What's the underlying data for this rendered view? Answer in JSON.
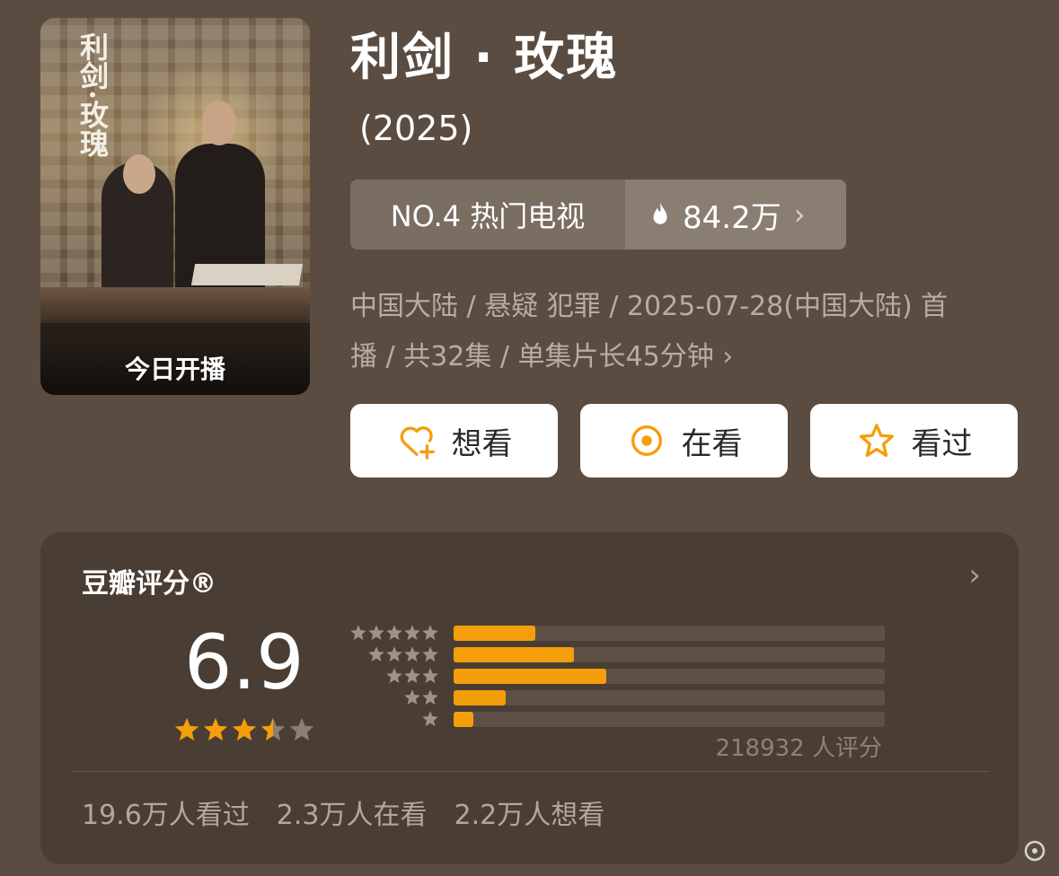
{
  "poster": {
    "vertical_title": "利剑·玫瑰",
    "caption": "今日开播"
  },
  "header": {
    "title": "利剑 · 玫瑰",
    "year": "(2025)"
  },
  "rank": {
    "label": "NO.4 热门电视",
    "heat": "84.2万",
    "chevron": "›",
    "flame_icon": "flame-icon"
  },
  "meta": {
    "line1": "中国大陆 / 悬疑 犯罪 / 2025-07-28(中国大陆) 首",
    "line2": "播 / 共32集 / 单集片长45分钟",
    "chevron": "›"
  },
  "actions": [
    {
      "label": "想看",
      "icon": "heart-plus-icon"
    },
    {
      "label": "在看",
      "icon": "target-icon"
    },
    {
      "label": "看过",
      "icon": "star-outline-icon"
    }
  ],
  "rating": {
    "title": "豆瓣评分®",
    "chevron": "›",
    "score": "6.9",
    "stars": 3.5,
    "distribution": [
      {
        "stars": 5,
        "fraction": 0.19
      },
      {
        "stars": 4,
        "fraction": 0.28
      },
      {
        "stars": 3,
        "fraction": 0.355
      },
      {
        "stars": 2,
        "fraction": 0.12
      },
      {
        "stars": 1,
        "fraction": 0.045
      }
    ],
    "votes": "218932 人评分",
    "stats": [
      "19.6万人看过",
      "2.3万人在看",
      "2.2万人想看"
    ]
  },
  "colors": {
    "background": "#5a4c41",
    "card": "#4a3d33",
    "accent": "#f59e0b"
  }
}
